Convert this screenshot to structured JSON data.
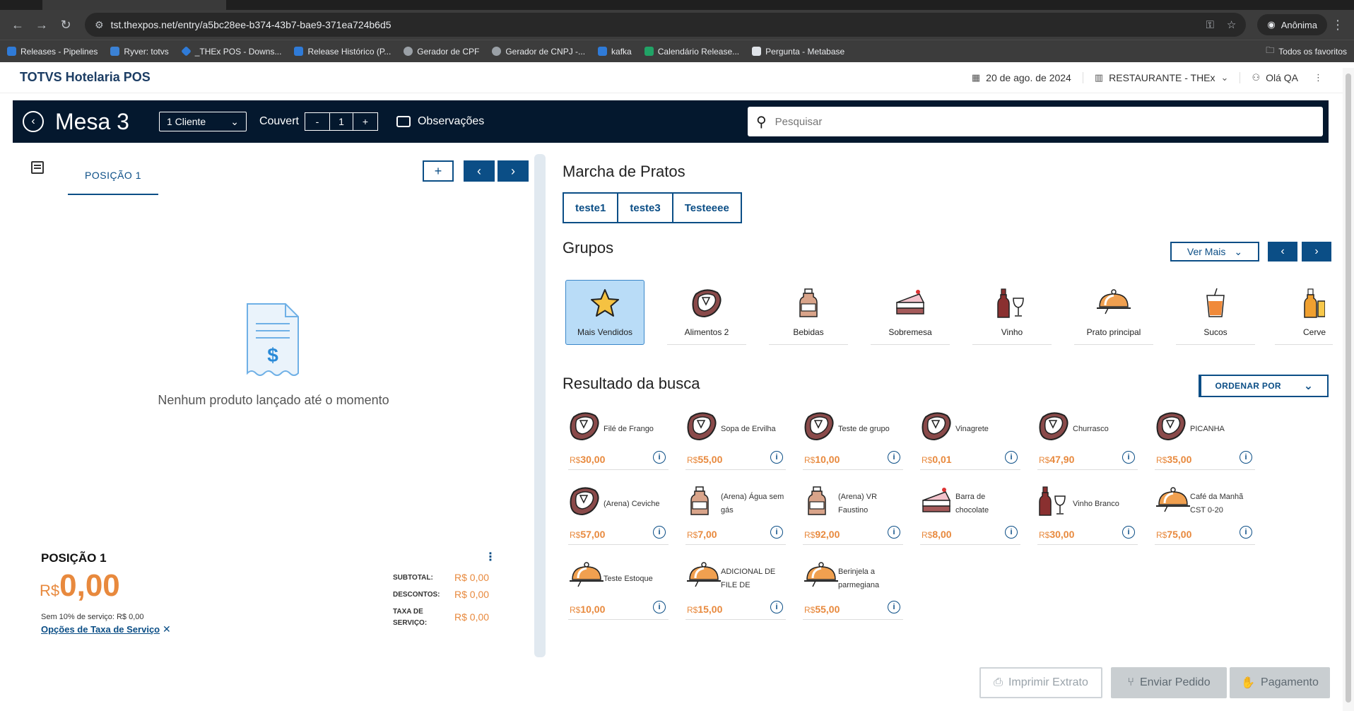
{
  "browser": {
    "url": "tst.thexpos.net/entry/a5bc28ee-b374-43b7-bae9-371ea724b6d5",
    "profile": "Anônima",
    "bookmarks": [
      {
        "label": "Releases - Pipelines",
        "color": "#2f7bd8"
      },
      {
        "label": "Ryver: totvs",
        "color": "#3b82d6"
      },
      {
        "label": "_THEx POS - Downs...",
        "color": "#2f7bd8"
      },
      {
        "label": "Release Histórico (P...",
        "color": "#2f7bd8"
      },
      {
        "label": "Gerador de CPF",
        "color": "#9aa0a6"
      },
      {
        "label": "Gerador de CNPJ -...",
        "color": "#9aa0a6"
      },
      {
        "label": "kafka",
        "color": "#2f7bd8"
      },
      {
        "label": "Calendário Release...",
        "color": "#21a366"
      },
      {
        "label": "Pergunta - Metabase",
        "color": "#dfe3e8"
      }
    ],
    "all_bookmarks": "Todos os favoritos"
  },
  "header": {
    "title": "TOTVS Hotelaria POS",
    "date": "20 de ago. de 2024",
    "store": "RESTAURANTE - THEx",
    "user": "Olá QA"
  },
  "toolbar": {
    "mesa": "Mesa 3",
    "client": "1 Cliente",
    "couvert_label": "Couvert",
    "couvert_minus": "-",
    "couvert_value": "1",
    "couvert_plus": "+",
    "observacoes": "Observações",
    "search_placeholder": "Pesquisar"
  },
  "left": {
    "position_tab": "POSIÇÃO 1",
    "add": "+",
    "prev": "‹",
    "next": "›",
    "empty_message": "Nenhum produto lançado até o momento",
    "summary_title": "POSIÇÃO 1",
    "total_currency": "R$",
    "total_amount": "0,00",
    "sem_servico": "Sem 10% de serviço: R$ 0,00",
    "taxa_link": "Opções de Taxa de Serviço",
    "subtotal_label": "SUBTOTAL:",
    "subtotal_value": "R$ 0,00",
    "descontos_label": "DESCONTOS:",
    "descontos_value": "R$ 0,00",
    "taxa_label_1": "TAXA DE",
    "taxa_label_2": "SERVIÇO:",
    "taxa_value": "R$ 0,00"
  },
  "right": {
    "marcha_title": "Marcha de Pratos",
    "marcha_tabs": [
      "teste1",
      "teste3",
      "Testeeee"
    ],
    "grupos_title": "Grupos",
    "ver_mais": "Ver Mais",
    "groups": [
      {
        "label": "Mais Vendidos",
        "icon": "star-icon"
      },
      {
        "label": "Alimentos 2",
        "icon": "steak-icon"
      },
      {
        "label": "Bebidas",
        "icon": "bottle-icon"
      },
      {
        "label": "Sobremesa",
        "icon": "cake-icon"
      },
      {
        "label": "Vinho",
        "icon": "wine-icon"
      },
      {
        "label": "Prato principal",
        "icon": "cloche-icon"
      },
      {
        "label": "Sucos",
        "icon": "juice-icon"
      },
      {
        "label": "Cerve",
        "icon": "beer-icon"
      }
    ],
    "resultado_title": "Resultado da busca",
    "ordenar": "ORDENAR POR",
    "currency": "R$",
    "products": [
      {
        "name": "Filé de Frango",
        "price": "30,00",
        "icon": "steak-icon"
      },
      {
        "name": "Sopa de Ervilha",
        "price": "55,00",
        "icon": "steak-icon"
      },
      {
        "name": "Teste de grupo",
        "price": "10,00",
        "icon": "steak-icon"
      },
      {
        "name": "Vinagrete",
        "price": "0,01",
        "icon": "steak-icon"
      },
      {
        "name": "Churrasco",
        "price": "47,90",
        "icon": "steak-icon"
      },
      {
        "name": "PICANHA",
        "price": "35,00",
        "icon": "steak-icon"
      },
      {
        "name": "(Arena) Ceviche",
        "price": "57,00",
        "icon": "steak-icon"
      },
      {
        "name": "(Arena) Água sem gás",
        "price": "7,00",
        "icon": "bottle-icon"
      },
      {
        "name": "(Arena) VR Faustino",
        "price": "92,00",
        "icon": "bottle-icon"
      },
      {
        "name": "Barra de chocolate",
        "price": "8,00",
        "icon": "cake-icon"
      },
      {
        "name": "Vinho Branco",
        "price": "30,00",
        "icon": "wine-icon"
      },
      {
        "name": "Café da Manhã CST 0-20",
        "price": "75,00",
        "icon": "cloche-icon"
      },
      {
        "name": "Teste Estoque",
        "price": "10,00",
        "icon": "cloche-icon"
      },
      {
        "name": "ADICIONAL DE FILE DE",
        "price": "15,00",
        "icon": "cloche-icon"
      },
      {
        "name": "Berinjela a parmegiana",
        "price": "55,00",
        "icon": "cloche-icon"
      }
    ]
  },
  "actions": {
    "imprimir": "Imprimir Extrato",
    "enviar": "Enviar Pedido",
    "pagamento": "Pagamento"
  },
  "colors": {
    "primary": "#0b4e86",
    "dark_bar": "#04182e",
    "price": "#e8893d",
    "accent_bg": "#b9dcf7"
  }
}
